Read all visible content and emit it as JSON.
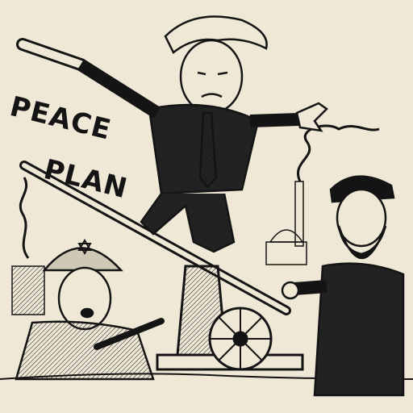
{
  "caption": {
    "line1": "PEACE",
    "line2": "PLAN"
  },
  "colors": {
    "paper": "#efe8d6",
    "ink": "#141414"
  }
}
